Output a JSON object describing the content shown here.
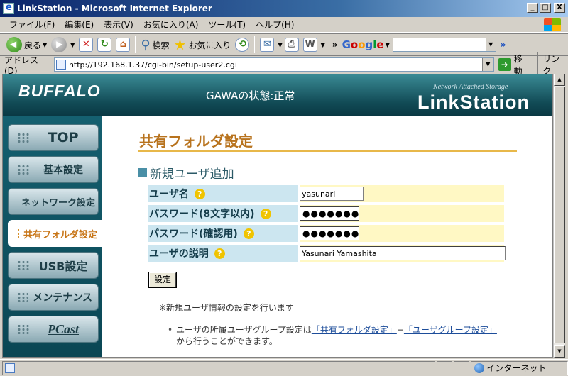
{
  "window": {
    "title": "LinkStation - Microsoft Internet Explorer",
    "controls": {
      "minimize": "_",
      "maximize": "□",
      "close": "X"
    }
  },
  "menu": [
    "ファイル(F)",
    "編集(E)",
    "表示(V)",
    "お気に入り(A)",
    "ツール(T)",
    "ヘルプ(H)"
  ],
  "toolbar": {
    "back_label": "戻る",
    "search_label": "検索",
    "favorites_label": "お気に入り",
    "google_letters": [
      "G",
      "o",
      "o",
      "g",
      "l",
      "e"
    ],
    "chevron": "»"
  },
  "address_bar": {
    "label": "アドレス(D)",
    "url": "http://192.168.1.37/cgi-bin/setup-user2.cgi",
    "go_label": "移動",
    "links_label": "リンク"
  },
  "header": {
    "logo": "BUFFALO",
    "status": "GAWAの状態:正常",
    "tagline": "Network Attached Storage",
    "brand": "LinkStation"
  },
  "sidebar": {
    "items": [
      {
        "label": "TOP",
        "active": false
      },
      {
        "label": "基本設定",
        "active": false
      },
      {
        "label": "ネットワーク設定",
        "active": false
      },
      {
        "label": "共有フォルダ設定",
        "active": true
      },
      {
        "label": "USB設定",
        "active": false
      },
      {
        "label": "メンテナンス",
        "active": false
      },
      {
        "label": "PCast",
        "active": false
      }
    ]
  },
  "main": {
    "page_title": "共有フォルダ設定",
    "section_title": "新規ユーザ追加",
    "help_glyph": "?",
    "fields": [
      {
        "label": "ユーザ名",
        "value": "yasunari",
        "type": "text"
      },
      {
        "label": "パスワード(8文字以内)",
        "value": "●●●●●●●",
        "type": "password"
      },
      {
        "label": "パスワード(確認用)",
        "value": "●●●●●●●",
        "type": "password"
      },
      {
        "label": "ユーザの説明",
        "value": "Yasunari Yamashita",
        "type": "text"
      }
    ],
    "submit_label": "設定",
    "note": "※新規ユーザ情報の設定を行います",
    "bullet_text_1": "ユーザの所属ユーザグループ設定は",
    "bullet_link_1": "「共有フォルダ設定」",
    "bullet_dash": "−",
    "bullet_link_2": "「ユーザグループ設定」",
    "bullet_text_2": "から行うことができます。"
  },
  "statusbar": {
    "zone": "インターネット"
  },
  "colors": {
    "header_teal": "#114a55",
    "accent_orange": "#b8731e",
    "label_bg": "#cce6f0",
    "field_bg": "#fff8c4",
    "link_blue": "#1d4d9a"
  }
}
